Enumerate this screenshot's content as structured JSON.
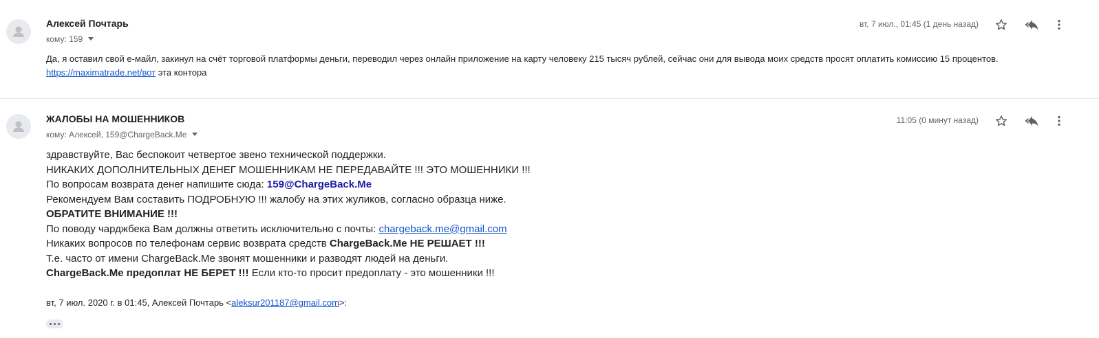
{
  "messages": [
    {
      "sender": "Алексей Почтарь",
      "recipients_label": "кому: 159",
      "date": "вт, 7 июл., 01:45 (1 день назад)",
      "body": {
        "text_before_link": "Да, я оставил свой е-майл, закинул на счёт торговой платформы деньги, переводил через онлайн приложение на карту человеку 215 тысяч рублей, сейчас они для вывода моих средств просят оплатить комиссию 15 процентов. ",
        "link": "https://maximatrade.net/вот",
        "text_after_link": " эта контора"
      }
    },
    {
      "sender": "ЖАЛОБЫ НА МОШЕННИКОВ",
      "recipients_label": "кому: Алексей, 159@ChargeBack.Me",
      "date": "11:05 (0 минут назад)",
      "body": {
        "line1": "здравствуйте, Вас беспокоит четвертое звено технической поддержки.",
        "line2": "НИКАКИХ ДОПОЛНИТЕЛЬНЫХ ДЕНЕГ МОШЕННИКАМ НЕ ПЕРЕДАВАЙТЕ !!! ЭТО МОШЕННИКИ !!!",
        "line3_text": "По вопросам возврата денег напишите сюда: ",
        "line3_email": "159@ChargeBack.Me",
        "line4": "Рекомендуем Вам составить ПОДРОБНУЮ !!! жалобу на этих жуликов, согласно образца ниже.",
        "line5": "ОБРАТИТЕ ВНИМАНИЕ !!!",
        "line6_text": "По поводу чарджбека Вам должны ответить исключительно с почты: ",
        "line6_email": "chargeback.me@gmail.com",
        "line7_text": "Никаких вопросов по телефонам сервис возврата средств ",
        "line7_bold": "ChargeBack.Me НЕ РЕШАЕТ !!!",
        "line8": "Т.е. часто от имени ChargeBack.Me звонят мошенники и разводят людей на деньги.",
        "line9_bold": "ChargeBack.Me предоплат НЕ БЕРЕТ !!!",
        "line9_text": " Если кто-то просит предоплату - это мошенники !!!"
      },
      "quote_header": {
        "text_before": "вт, 7 июл. 2020 г. в 01:45, Алексей Почтарь <",
        "email": "aleksur201187@gmail.com",
        "text_after": ">:"
      }
    }
  ],
  "icons": {
    "avatar": "person-icon",
    "star": "star-icon",
    "reply": "reply-all-icon",
    "more": "more-vert-icon",
    "expand": "ellipsis-icon"
  },
  "colors": {
    "link": "#1155cc",
    "highlight_email": "#1a1aa6",
    "meta_text": "#5f6368",
    "avatar_bg": "#e8eaed"
  }
}
